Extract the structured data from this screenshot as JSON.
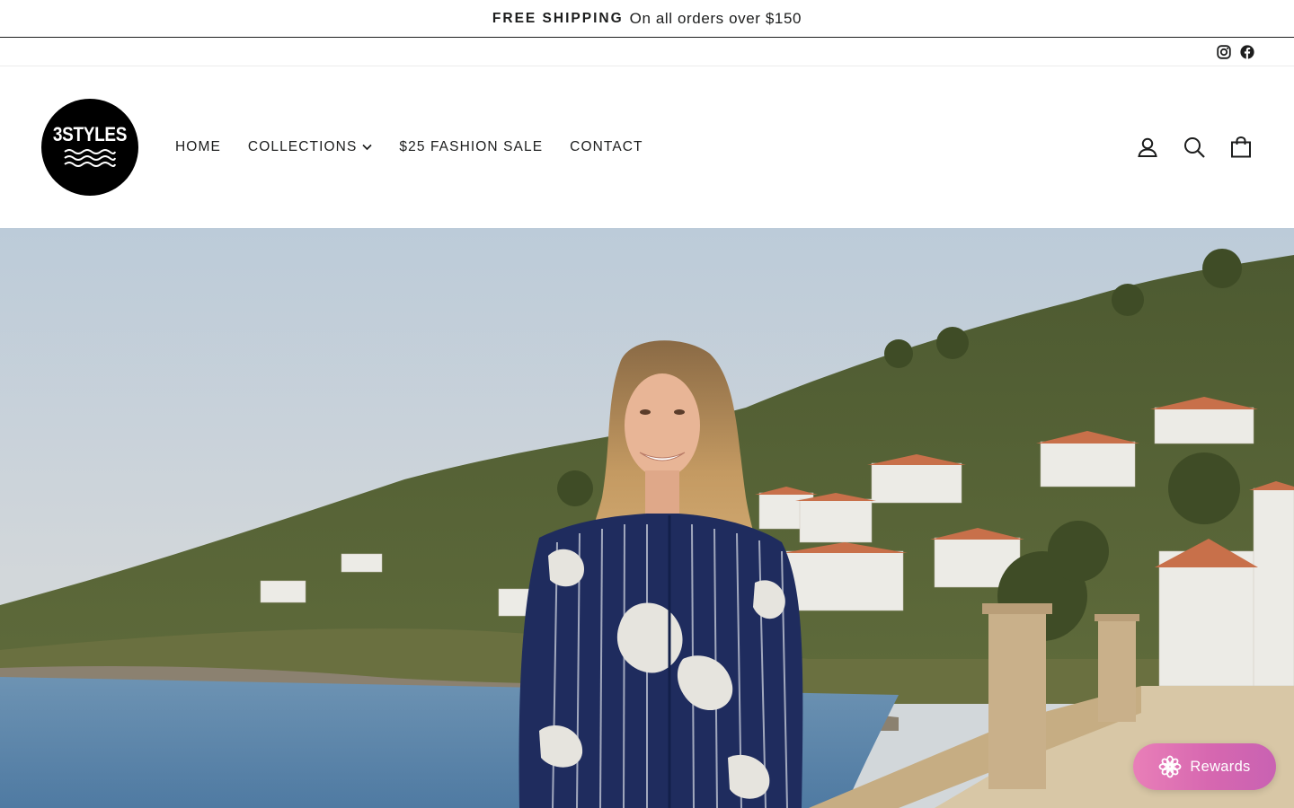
{
  "announcement": {
    "bold": "FREE SHIPPING",
    "text": "On all orders over $150"
  },
  "social": {
    "icons": [
      "instagram-icon",
      "facebook-icon"
    ]
  },
  "logo": {
    "text": "3STYLES"
  },
  "nav": {
    "items": [
      {
        "label": "HOME"
      },
      {
        "label": "COLLECTIONS",
        "icon": "chevron-down-icon"
      },
      {
        "label": "$25 FASHION SALE"
      },
      {
        "label": "CONTACT"
      }
    ]
  },
  "header_icons": [
    "account-icon",
    "search-icon",
    "cart-bag-icon"
  ],
  "hero": {
    "scene": "woman in navy floral striped dress smiling on a seaside promenade with hillside villas"
  },
  "rewards": {
    "label": "Rewards",
    "icon": "flower-icon"
  },
  "colors": {
    "text": "#1c1d1d",
    "rewards_gradient_start": "#e97fb8",
    "rewards_gradient_end": "#c962b2",
    "logo_bg": "#000000"
  }
}
